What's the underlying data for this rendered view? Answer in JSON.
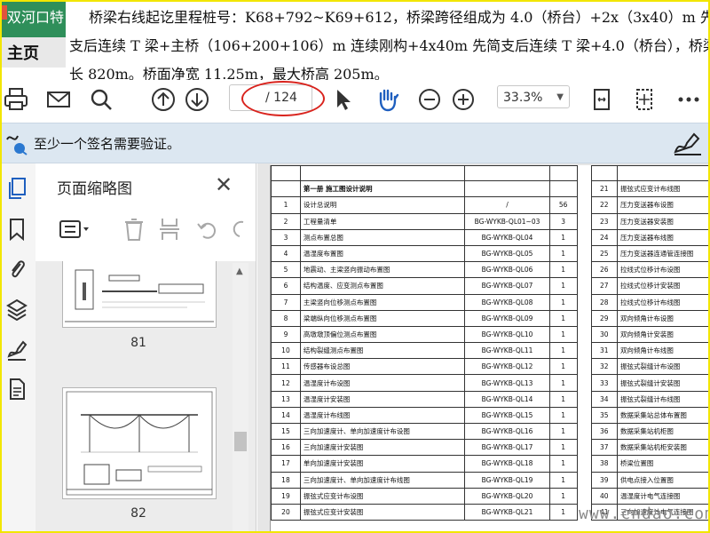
{
  "top_tab": {
    "label": "双河口特"
  },
  "home_tab": {
    "label": "主页"
  },
  "doc_text": {
    "line1": "桥梁右线起讫里程桩号：K68+792~K69+612，桥梁跨径组成为 4.0（桥台）+2x（3x40）m 先简",
    "line2": "支后连续 T 梁+主桥（106+200+106）m  连续刚构+4x40m 先简支后连续 T 梁+4.0（桥台），桥梁全",
    "line3": "长 820m。桥面净宽  11.25m，最大桥高 205m。"
  },
  "toolbar": {
    "page_total": "/ 124",
    "zoom": "33.3%",
    "icons": [
      "print-icon",
      "mail-icon",
      "search-icon",
      "page-up-icon",
      "page-down-icon",
      "select-arrow-icon",
      "hand-icon",
      "zoom-out-icon",
      "zoom-in-icon",
      "fit-page-icon",
      "rotate-icon",
      "more-icon"
    ]
  },
  "signature_bar": {
    "message": "至少一个签名需要验证。"
  },
  "panel": {
    "title": "页面缩略图",
    "thumbs": [
      {
        "label": "81"
      },
      {
        "label": "82"
      }
    ]
  },
  "table": {
    "header": "第一册 施工图设计说明",
    "rows": [
      {
        "n": "1",
        "title": "设计总说明",
        "code": "/",
        "count": "56"
      },
      {
        "n": "2",
        "title": "工程量清单",
        "code": "BG-WYKB-QL01~03",
        "count": "3"
      },
      {
        "n": "3",
        "title": "测点布置总图",
        "code": "BG-WYKB-QL04",
        "count": "1"
      },
      {
        "n": "4",
        "title": "温湿度布置图",
        "code": "BG-WYKB-QL05",
        "count": "1"
      },
      {
        "n": "5",
        "title": "地震动、主梁竖向振动布置图",
        "code": "BG-WYKB-QL06",
        "count": "1"
      },
      {
        "n": "6",
        "title": "结构温度、应变测点布置图",
        "code": "BG-WYKB-QL07",
        "count": "1"
      },
      {
        "n": "7",
        "title": "主梁竖向位移测点布置图",
        "code": "BG-WYKB-QL08",
        "count": "1"
      },
      {
        "n": "8",
        "title": "梁端纵向位移测点布置图",
        "code": "BG-WYKB-QL09",
        "count": "1"
      },
      {
        "n": "9",
        "title": "高墩墩顶偏位测点布置图",
        "code": "BG-WYKB-QL10",
        "count": "1"
      },
      {
        "n": "10",
        "title": "结构裂缝测点布置图",
        "code": "BG-WYKB-QL11",
        "count": "1"
      },
      {
        "n": "11",
        "title": "传感器布设总图",
        "code": "BG-WYKB-QL12",
        "count": "1"
      },
      {
        "n": "12",
        "title": "温湿度计布设图",
        "code": "BG-WYKB-QL13",
        "count": "1"
      },
      {
        "n": "13",
        "title": "温湿度计安装图",
        "code": "BG-WYKB-QL14",
        "count": "1"
      },
      {
        "n": "14",
        "title": "温湿度计布线图",
        "code": "BG-WYKB-QL15",
        "count": "1"
      },
      {
        "n": "15",
        "title": "三向加速度计、单向加速度计布设图",
        "code": "BG-WYKB-QL16",
        "count": "1"
      },
      {
        "n": "16",
        "title": "三向加速度计安装图",
        "code": "BG-WYKB-QL17",
        "count": "1"
      },
      {
        "n": "17",
        "title": "单向加速度计安装图",
        "code": "BG-WYKB-QL18",
        "count": "1"
      },
      {
        "n": "18",
        "title": "三向加速度计、单向加速度计布线图",
        "code": "BG-WYKB-QL19",
        "count": "1"
      },
      {
        "n": "19",
        "title": "振弦式应变计布设图",
        "code": "BG-WYKB-QL20",
        "count": "1"
      },
      {
        "n": "20",
        "title": "振弦式应变计安装图",
        "code": "BG-WYKB-QL21",
        "count": "1"
      }
    ],
    "right_rows": [
      {
        "n": "21",
        "title": "振弦式应变计布线图"
      },
      {
        "n": "22",
        "title": "压力变送器布设图"
      },
      {
        "n": "23",
        "title": "压力变送器安装图"
      },
      {
        "n": "24",
        "title": "压力变送器布线图"
      },
      {
        "n": "25",
        "title": "压力变送器连通管连接图"
      },
      {
        "n": "26",
        "title": "拉线式位移计布设图"
      },
      {
        "n": "27",
        "title": "拉线式位移计安装图"
      },
      {
        "n": "28",
        "title": "拉线式位移计布线图"
      },
      {
        "n": "29",
        "title": "双向倾角计布设图"
      },
      {
        "n": "30",
        "title": "双向倾角计安装图"
      },
      {
        "n": "31",
        "title": "双向倾角计布线图"
      },
      {
        "n": "32",
        "title": "振弦式裂缝计布设图"
      },
      {
        "n": "33",
        "title": "振弦式裂缝计安装图"
      },
      {
        "n": "34",
        "title": "振弦式裂缝计布线图"
      },
      {
        "n": "35",
        "title": "数据采集站总体布置图"
      },
      {
        "n": "36",
        "title": "数据采集站机柜图"
      },
      {
        "n": "37",
        "title": "数据采集站机柜安装图"
      },
      {
        "n": "38",
        "title": "桥梁位置图"
      },
      {
        "n": "39",
        "title": "供电点接入位置图"
      },
      {
        "n": "40",
        "title": "温湿度计电气连接图"
      },
      {
        "n": "41",
        "title": "三向加速度计电气连接图"
      }
    ]
  },
  "watermark": "www.cndao.com"
}
